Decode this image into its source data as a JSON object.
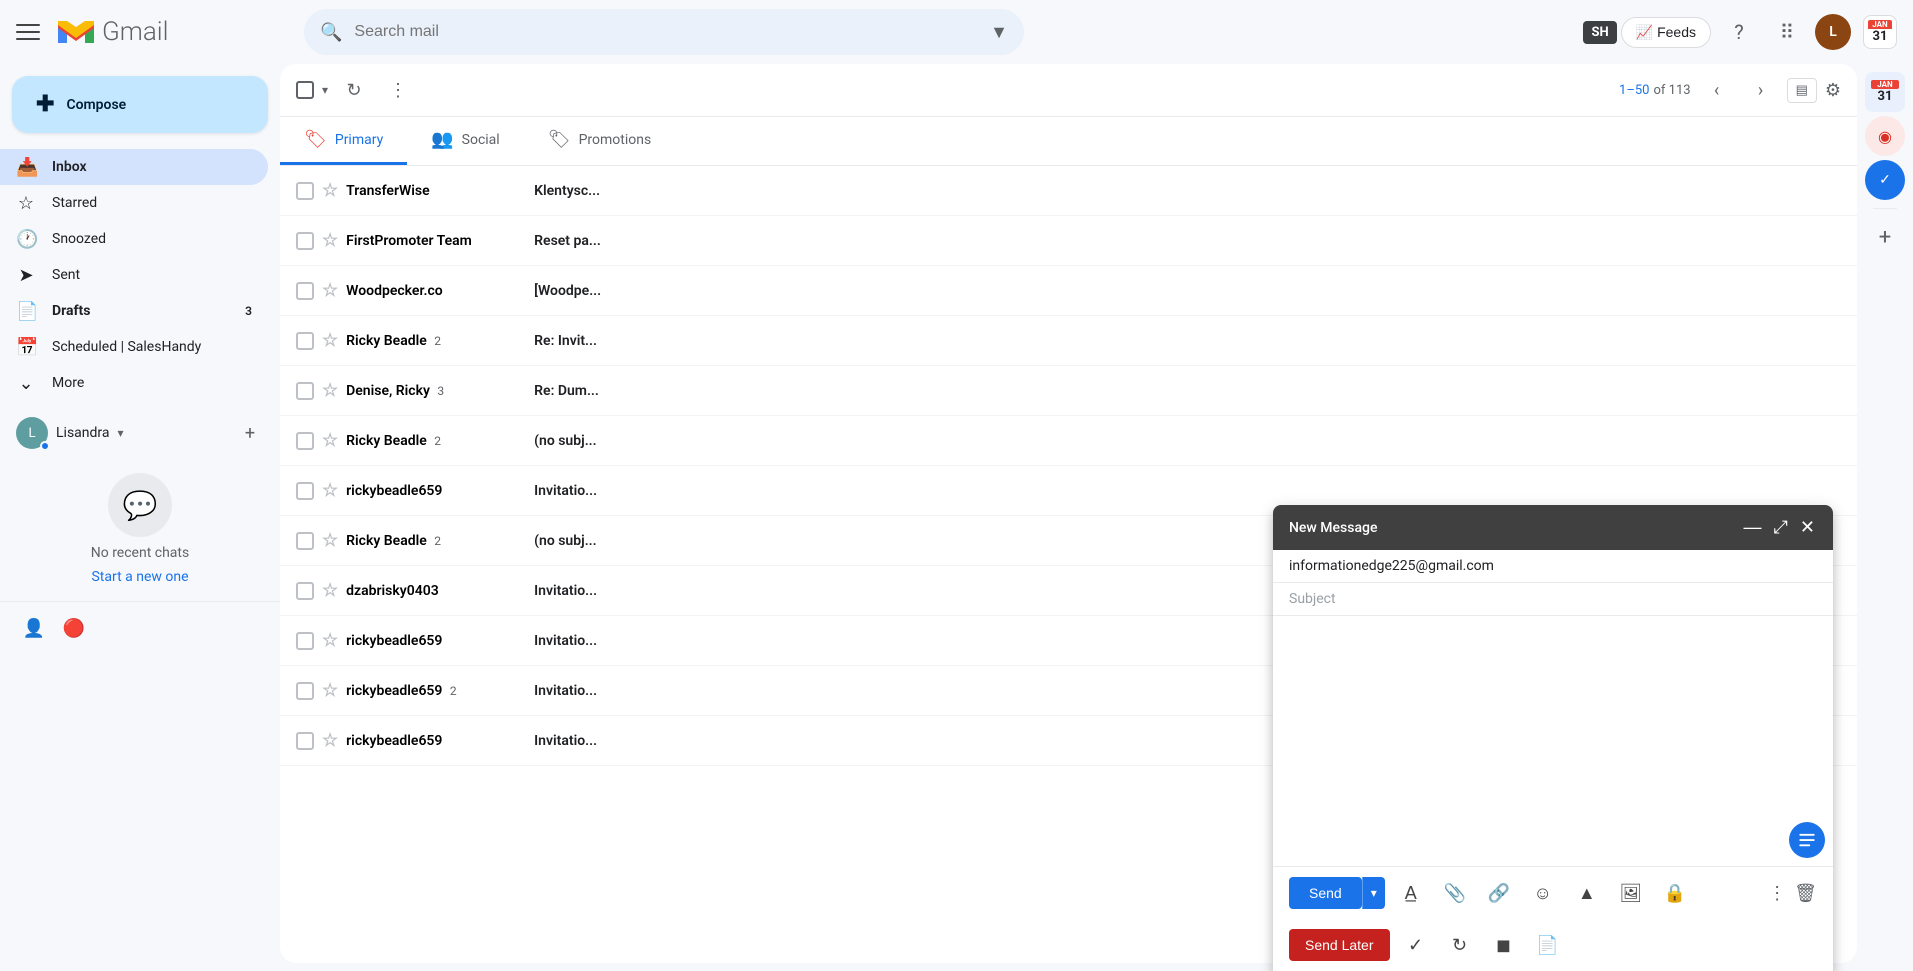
{
  "topbar": {
    "hamburger_label": "Main menu",
    "gmail_label": "Gmail",
    "search_placeholder": "Search mail",
    "sh_badge": "SH",
    "feeds_label": "Feeds",
    "avatar_letter": "L"
  },
  "sidebar": {
    "compose_label": "Compose",
    "nav_items": [
      {
        "id": "inbox",
        "label": "Inbox",
        "icon": "📥",
        "badge": "",
        "active": true
      },
      {
        "id": "starred",
        "label": "Starred",
        "icon": "☆",
        "badge": ""
      },
      {
        "id": "snoozed",
        "label": "Snoozed",
        "icon": "🕐",
        "badge": ""
      },
      {
        "id": "sent",
        "label": "Sent",
        "icon": "➤",
        "badge": ""
      },
      {
        "id": "drafts",
        "label": "Drafts",
        "icon": "📄",
        "badge": "3"
      },
      {
        "id": "scheduled",
        "label": "Scheduled | SalesHandy",
        "icon": "📅",
        "badge": ""
      },
      {
        "id": "more",
        "label": "More",
        "icon": "⌄",
        "badge": ""
      }
    ],
    "account_name": "Lisandra",
    "chat_no_recent": "No recent chats",
    "chat_start_new": "Start a new one"
  },
  "toolbar": {
    "pagination_text": "1–50 of 113",
    "pagination_accent": "1–50",
    "pagination_total": "of 113"
  },
  "tabs": [
    {
      "id": "primary",
      "label": "Primary",
      "icon": "🏷️",
      "active": true
    },
    {
      "id": "social",
      "label": "Social",
      "icon": "👥"
    },
    {
      "id": "promotions",
      "label": "Promotions",
      "icon": "🏷"
    }
  ],
  "emails": [
    {
      "sender": "TransferWise",
      "subject": "Klentysc...",
      "read": false,
      "count": ""
    },
    {
      "sender": "FirstPromoter Team",
      "subject": "Reset pa...",
      "read": false,
      "count": ""
    },
    {
      "sender": "Woodpecker.co",
      "subject": "[Woodpe...",
      "read": false,
      "count": ""
    },
    {
      "sender": "Ricky Beadle",
      "subject": "Re: Invit...",
      "read": false,
      "count": "2"
    },
    {
      "sender": "Denise, Ricky",
      "subject": "Re: Dum...",
      "read": false,
      "count": "3"
    },
    {
      "sender": "Ricky Beadle",
      "subject": "(no subj...",
      "read": false,
      "count": "2"
    },
    {
      "sender": "rickybeadle659",
      "subject": "Invitatio...",
      "read": false,
      "count": ""
    },
    {
      "sender": "Ricky Beadle",
      "subject": "(no subj...",
      "read": false,
      "count": "2"
    },
    {
      "sender": "dzabrisky0403",
      "subject": "Invitatio...",
      "read": false,
      "count": ""
    },
    {
      "sender": "rickybeadle659",
      "subject": "Invitatio...",
      "read": false,
      "count": ""
    },
    {
      "sender": "rickybeadle659",
      "subject": "Invitatio...",
      "read": false,
      "count": "2"
    },
    {
      "sender": "rickybeadle659",
      "subject": "Invitatio...",
      "read": false,
      "count": ""
    }
  ],
  "compose": {
    "title": "New Message",
    "to": "informationedge225@gmail.com",
    "subject_placeholder": "Subject",
    "send_label": "Send",
    "send_later_label": "Send Later"
  }
}
